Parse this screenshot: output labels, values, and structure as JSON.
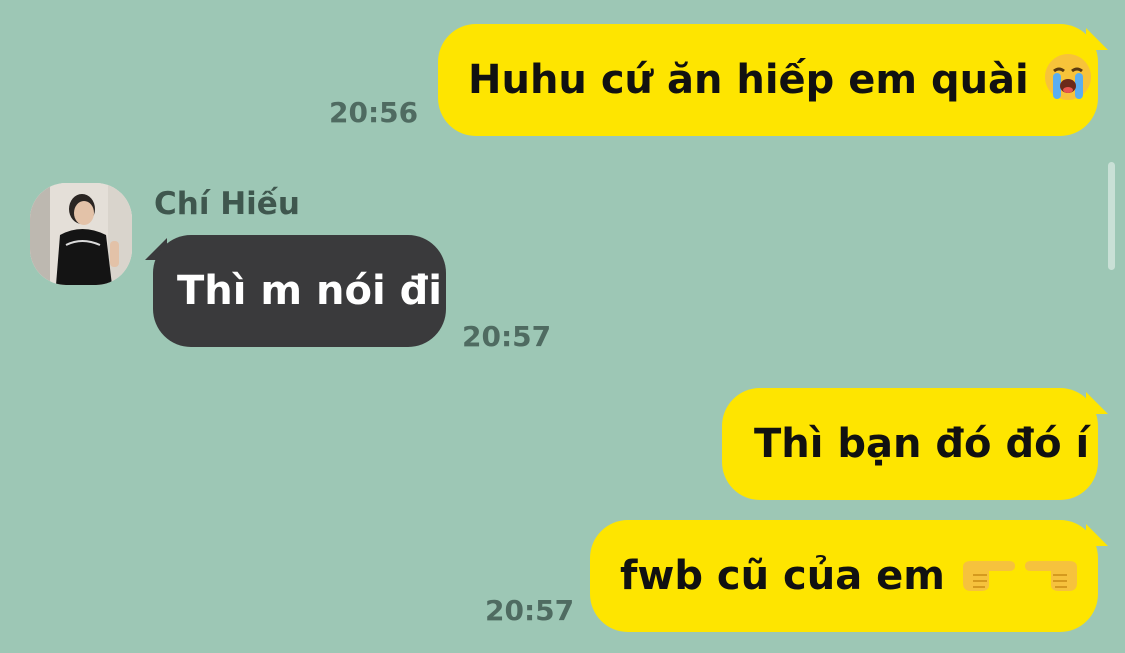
{
  "messages": [
    {
      "text": "Huhu cứ ăn hiếp em quài",
      "emoji_name": "loudly-crying-face-icon",
      "time": "20:56"
    },
    {
      "sender": "Chí Hiếu",
      "text": "Thì m nói đi",
      "time": "20:57"
    },
    {
      "text": "Thì bạn đó đó í"
    },
    {
      "text": "fwb cũ của em",
      "emoji_names": [
        "backhand-index-pointing-right-icon",
        "backhand-index-pointing-left-icon"
      ],
      "time": "20:57"
    }
  ],
  "colors": {
    "background": "#9dc7b5",
    "mine_bubble": "#fee500",
    "theirs_bubble": "#3a3a3c"
  }
}
